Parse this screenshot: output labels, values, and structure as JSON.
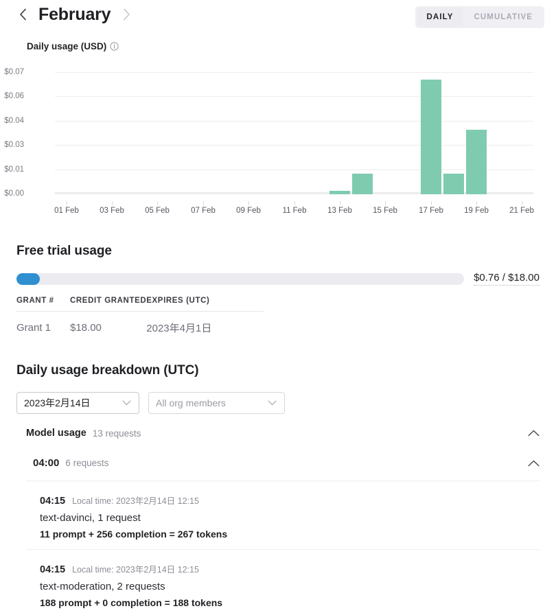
{
  "header": {
    "month": "February",
    "prev_icon": "chevron-left-icon",
    "next_icon": "chevron-right-icon",
    "toggle": {
      "daily": "DAILY",
      "cumulative": "CUMULATIVE",
      "active": "DAILY"
    }
  },
  "chart_section": {
    "label": "Daily usage (USD)",
    "info_icon": "info-icon"
  },
  "chart_data": {
    "type": "bar",
    "title": "Daily usage (USD)",
    "xlabel": "",
    "ylabel": "",
    "categories": [
      "01 Feb",
      "02 Feb",
      "03 Feb",
      "04 Feb",
      "05 Feb",
      "06 Feb",
      "07 Feb",
      "08 Feb",
      "09 Feb",
      "10 Feb",
      "11 Feb",
      "12 Feb",
      "13 Feb",
      "14 Feb",
      "15 Feb",
      "16 Feb",
      "17 Feb",
      "18 Feb",
      "19 Feb",
      "20 Feb",
      "21 Feb"
    ],
    "values": [
      0,
      0,
      0,
      0,
      0,
      0,
      0,
      0,
      0,
      0,
      0,
      0,
      0.002,
      0.012,
      0,
      0,
      0.066,
      0.012,
      0.037,
      0,
      0
    ],
    "ytick_labels": [
      "$0.07",
      "$0.06",
      "$0.04",
      "$0.03",
      "$0.01",
      "$0.00"
    ],
    "ytick_values": [
      0.07,
      0.06,
      0.04,
      0.03,
      0.01,
      0.0
    ],
    "xtick_labels": [
      "01 Feb",
      "03 Feb",
      "05 Feb",
      "07 Feb",
      "09 Feb",
      "11 Feb",
      "13 Feb",
      "15 Feb",
      "17 Feb",
      "19 Feb",
      "21 Feb"
    ],
    "ylim": [
      0,
      0.07
    ],
    "grid": true,
    "legend": "none",
    "bar_color": "#7ecbb0"
  },
  "free_trial": {
    "title": "Free trial usage",
    "progress_text": "$0.76 / $18.00",
    "used": 0.76,
    "total": 18.0,
    "percent": 4.2,
    "fill_color": "#2f8fd0",
    "table": {
      "columns": [
        "GRANT #",
        "CREDIT GRANTED",
        "EXPIRES (UTC)"
      ],
      "rows": [
        [
          "Grant 1",
          "$18.00",
          "2023年4月1日"
        ]
      ]
    }
  },
  "breakdown": {
    "title": "Daily usage breakdown (UTC)",
    "date_select": {
      "value": "2023年2月14日",
      "caret_icon": "chevron-down-icon"
    },
    "member_select": {
      "placeholder": "All org members",
      "caret_icon": "chevron-down-icon"
    },
    "model_usage": {
      "label": "Model usage",
      "count": "13 requests",
      "chevron_icon": "chevron-up-icon"
    },
    "hour_group": {
      "time": "04:00",
      "count": "6 requests",
      "chevron_icon": "chevron-up-icon"
    },
    "entries": [
      {
        "time": "04:15",
        "local": "Local time: 2023年2月14日 12:15",
        "model": "text-davinci, 1 request",
        "tokens": "11 prompt + 256 completion = 267 tokens"
      },
      {
        "time": "04:15",
        "local": "Local time: 2023年2月14日 12:15",
        "model": "text-moderation, 2 requests",
        "tokens": "188 prompt + 0 completion = 188 tokens"
      }
    ]
  }
}
